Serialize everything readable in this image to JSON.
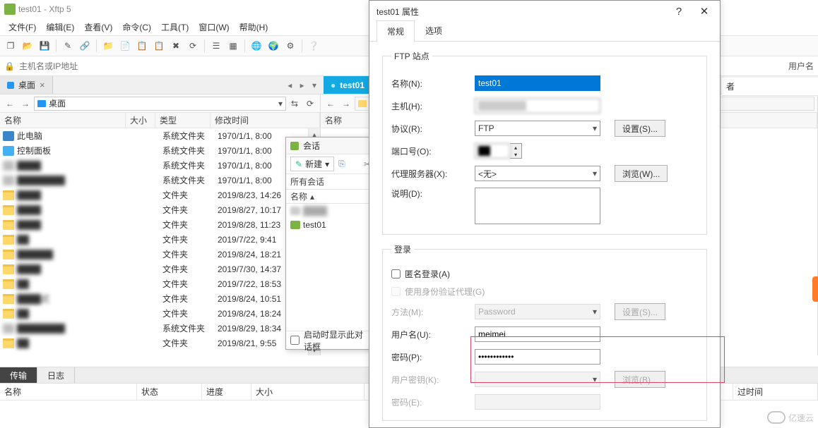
{
  "title": "test01  -  Xftp 5",
  "menubar": [
    "文件(F)",
    "编辑(E)",
    "查看(V)",
    "命令(C)",
    "工具(T)",
    "窗口(W)",
    "帮助(H)"
  ],
  "toolbar_icons": [
    "new-session",
    "open",
    "save",
    "sep",
    "edit",
    "link",
    "sep",
    "folder-new",
    "file-new",
    "copy",
    "paste",
    "delete",
    "refresh",
    "sep",
    "view-list",
    "view-detail",
    "sep",
    "earth",
    "earth-green",
    "gear",
    "sep",
    "help"
  ],
  "addressbar": {
    "placeholder": "主机名或IP地址",
    "user_label": "用户名"
  },
  "toptabs": {
    "left": {
      "label": "桌面",
      "icon": "folder-blue"
    },
    "right": {
      "label": "test01",
      "active": true
    }
  },
  "left_pane": {
    "addr": {
      "icon": "folder-blue",
      "text": "桌面"
    },
    "columns": [
      "名称",
      "大小",
      "类型",
      "修改时间"
    ],
    "rows": [
      {
        "icon": "pc",
        "name": "此电脑",
        "type": "系统文件夹",
        "mtime": "1970/1/1, 8:00"
      },
      {
        "icon": "panel",
        "name": "控制面板",
        "type": "系统文件夹",
        "mtime": "1970/1/1, 8:00"
      },
      {
        "icon": "blur",
        "name": "████",
        "type": "系统文件夹",
        "mtime": "1970/1/1, 8:00"
      },
      {
        "icon": "blur",
        "name": "████████",
        "type": "系统文件夹",
        "mtime": "1970/1/1, 8:00"
      },
      {
        "icon": "folder",
        "name": "████",
        "type": "文件夹",
        "mtime": "2019/8/23, 14:26"
      },
      {
        "icon": "folder",
        "name": "████",
        "type": "文件夹",
        "mtime": "2019/8/27, 10:17"
      },
      {
        "icon": "folder",
        "name": "████",
        "type": "文件夹",
        "mtime": "2019/8/28, 11:23"
      },
      {
        "icon": "folder",
        "name": "██",
        "type": "文件夹",
        "mtime": "2019/7/22, 9:41"
      },
      {
        "icon": "folder",
        "name": "██████",
        "type": "文件夹",
        "mtime": "2019/8/24, 18:21"
      },
      {
        "icon": "folder",
        "name": "████",
        "type": "文件夹",
        "mtime": "2019/7/30, 14:37"
      },
      {
        "icon": "folder",
        "name": "██",
        "type": "文件夹",
        "mtime": "2019/7/22, 18:53"
      },
      {
        "icon": "folder",
        "name": "████式",
        "type": "文件夹",
        "mtime": "2019/8/24, 10:51"
      },
      {
        "icon": "folder",
        "name": "██",
        "type": "文件夹",
        "mtime": "2019/8/24, 18:24"
      },
      {
        "icon": "blur",
        "name": "████████",
        "type": "系统文件夹",
        "mtime": "2019/8/29, 18:34"
      },
      {
        "icon": "folder",
        "name": "██",
        "type": "文件夹",
        "mtime": "2019/8/21, 9:55"
      }
    ]
  },
  "right_pane": {
    "columns": [
      "名称"
    ]
  },
  "session_popup": {
    "title": "会话",
    "new_btn": "新建",
    "all_sessions": "所有会话",
    "col": "名称",
    "rows": [
      {
        "name": "████",
        "blur": true
      },
      {
        "name": "test01",
        "blur": false
      }
    ],
    "footer_chk": "启动时显示此对话框"
  },
  "bottom": {
    "tabs": [
      "传输",
      "日志"
    ],
    "active_tab": 0,
    "columns": [
      "名称",
      "状态",
      "进度",
      "大小",
      "",
      "过时间"
    ]
  },
  "remote_sliver_col": "者",
  "dialog": {
    "title": "test01 属性",
    "tabs": [
      "常规",
      "选项"
    ],
    "active_tab": 0,
    "groups": {
      "site": {
        "legend": "FTP 站点",
        "name": {
          "label": "名称(N):",
          "value": "test01"
        },
        "host": {
          "label": "主机(H):",
          "value": ""
        },
        "protocol": {
          "label": "协议(R):",
          "value": "FTP",
          "settings_btn": "设置(S)..."
        },
        "port": {
          "label": "端口号(O):",
          "value": ""
        },
        "proxy": {
          "label": "代理服务器(X):",
          "value": "<无>",
          "browse_btn": "浏览(W)..."
        },
        "desc": {
          "label": "说明(D):",
          "value": ""
        }
      },
      "login": {
        "legend": "登录",
        "anon": {
          "label": "匿名登录(A)",
          "checked": false
        },
        "agent": {
          "label": "使用身份验证代理(G)",
          "checked": false,
          "disabled": true
        },
        "method": {
          "label": "方法(M):",
          "value": "Password",
          "settings_btn": "设置(S)...",
          "disabled": true
        },
        "user": {
          "label": "用户名(U):",
          "value": "meimei"
        },
        "pass": {
          "label": "密码(P):",
          "value": "●●●●●●●●●●●●"
        },
        "userkey": {
          "label": "用户密钥(K):",
          "value": "",
          "browse_btn": "浏览(B)...",
          "disabled": true
        },
        "keypass": {
          "label": "密码(E):",
          "value": "",
          "disabled": true
        }
      }
    }
  },
  "watermark": "亿速云"
}
